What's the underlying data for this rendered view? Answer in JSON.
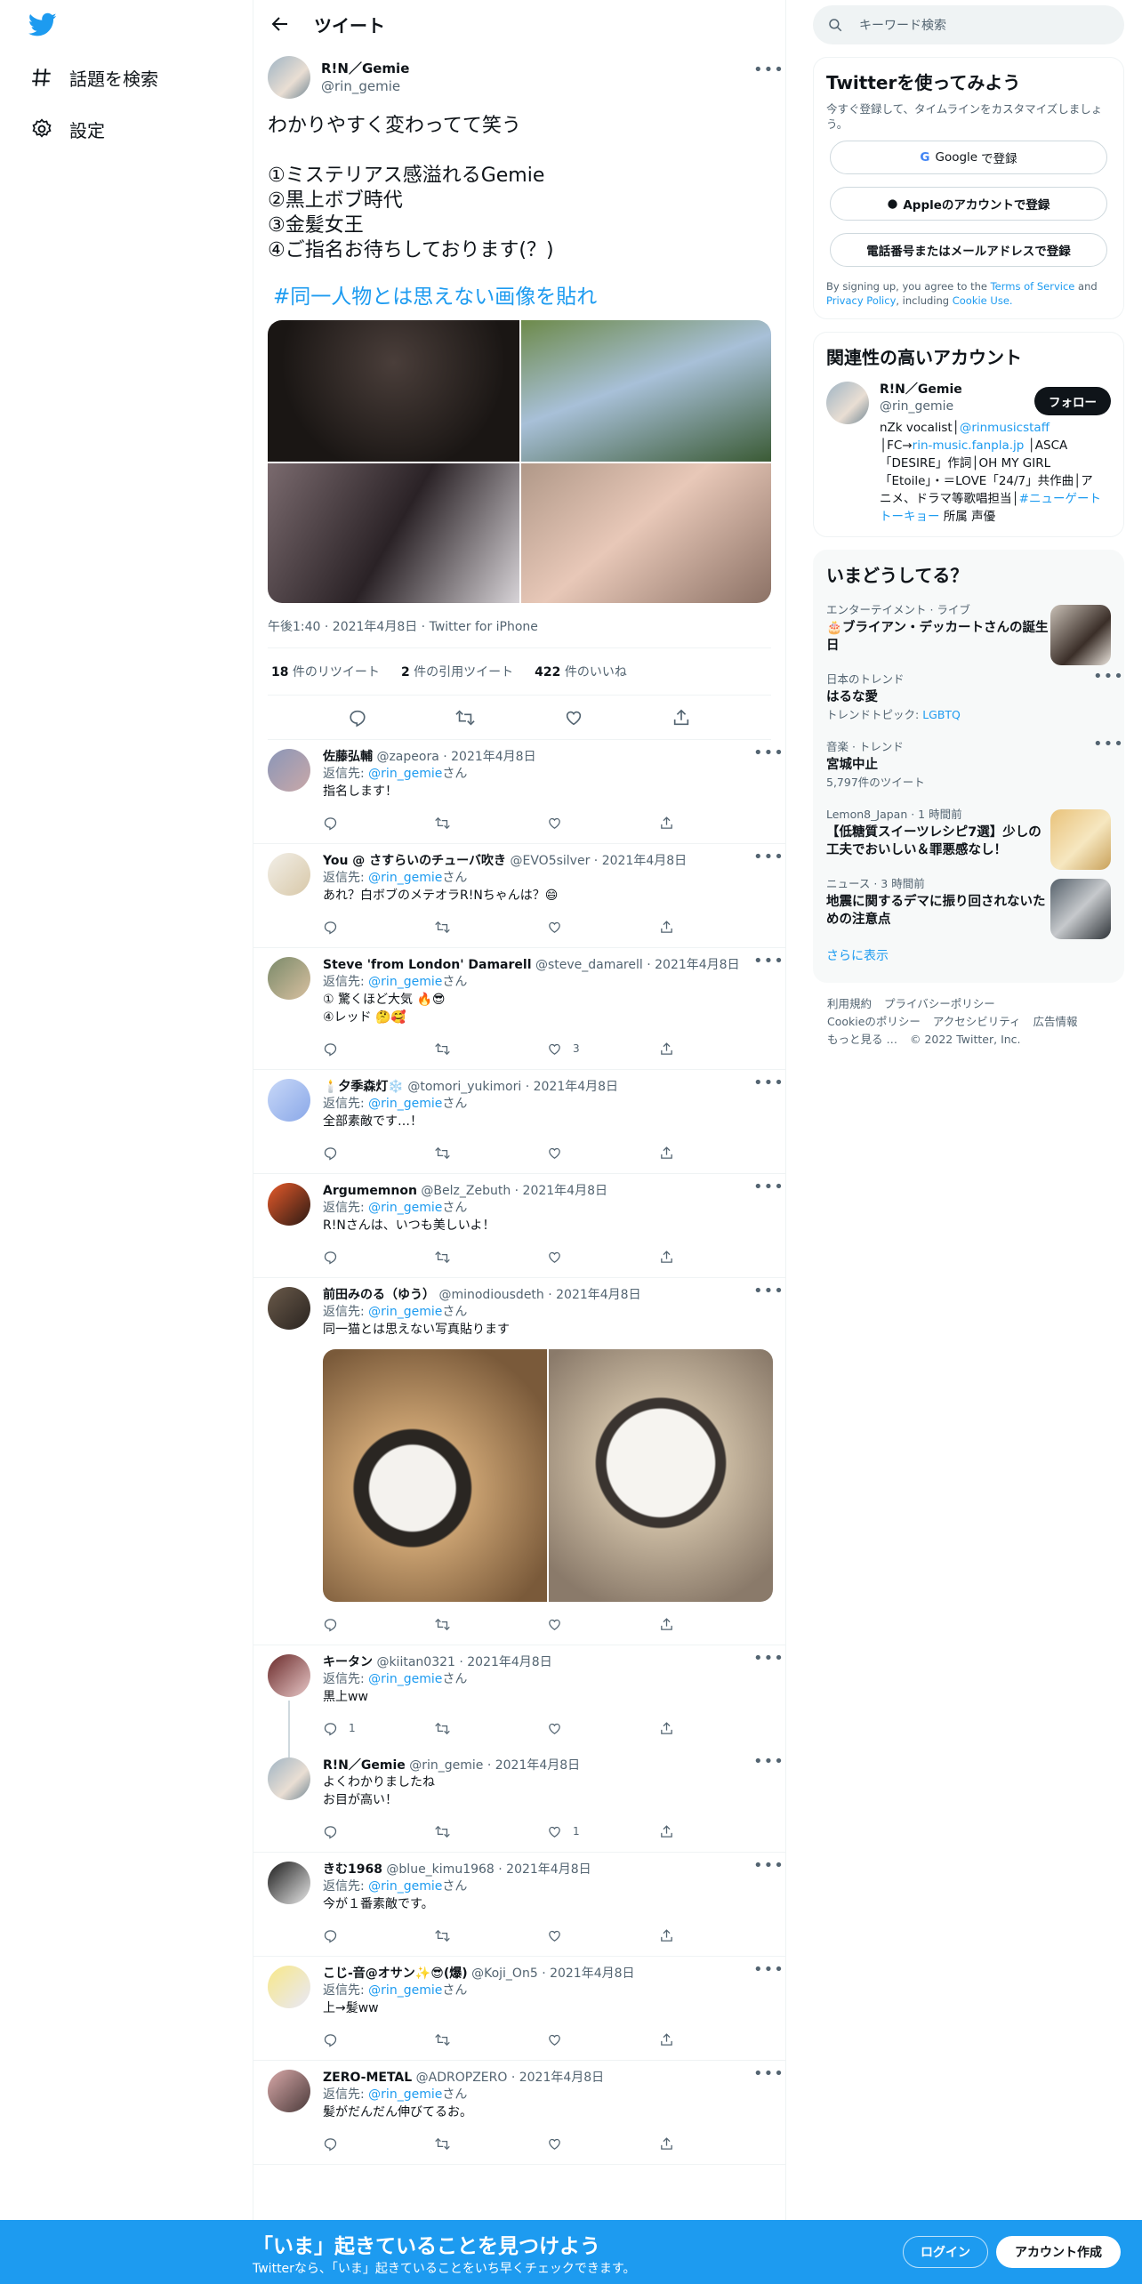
{
  "nav": {
    "explore_label": "話題を検索",
    "settings_label": "設定"
  },
  "header": {
    "title": "ツイート"
  },
  "main_tweet": {
    "name": "R!N／Gemie",
    "handle": "@rin_gemie",
    "text": "わかりやすく変わってて笑う\n\n①ミステリアス感溢れるGemie\n②黒上ボブ時代\n③金髪女王\n④ご指名お待ちしております(？)",
    "hashtag": "#同一人物とは思えない画像を貼れ",
    "meta": "午後1:40 · 2021年4月8日 · Twitter for iPhone",
    "retweets_count": "18",
    "retweets_label": " 件のリツイート",
    "quotes_count": "2",
    "quotes_label": " 件の引用ツイート",
    "likes_count": "422",
    "likes_label": " 件のいいね"
  },
  "reply_to_label": "返信先: ",
  "reply_to_suffix": "さん",
  "replies": [
    {
      "name": "佐藤弘輔",
      "handle": "@zapeora",
      "date": "· 2021年4月8日",
      "reply_to": "@rin_gemie",
      "text": "指名します！",
      "replies": "",
      "likes": ""
    },
    {
      "name": "You @ さすらいのチューバ吹き",
      "handle": "@EVO5silver",
      "date": "· 2021年4月8日",
      "reply_to": "@rin_gemie",
      "text": "あれ？白ボブのメテオラR!Nちゃんは？😄",
      "replies": "",
      "likes": ""
    },
    {
      "name": "Steve 'from London' Damarell",
      "handle": "@steve_damarell",
      "date": "· 2021年4月8日",
      "reply_to": "@rin_gemie",
      "text": "① 驚くほど大気 🔥😎\n④レッド 🤔🥰",
      "replies": "",
      "likes": "3"
    },
    {
      "name": "🕯️夕季森灯❄️",
      "handle": "@tomori_yukimori",
      "date": "· 2021年4月8日",
      "reply_to": "@rin_gemie",
      "text": "全部素敵です…！",
      "replies": "",
      "likes": ""
    },
    {
      "name": "Argumemnon",
      "handle": "@Belz_Zebuth",
      "date": "· 2021年4月8日",
      "reply_to": "@rin_gemie",
      "text": "R!Nさんは、いつも美しいよ！",
      "replies": "",
      "likes": ""
    },
    {
      "name": "前田みのる（ゆう）",
      "handle": "@minodiousdeth",
      "date": "· 2021年4月8日",
      "reply_to": "@rin_gemie",
      "text": "同一猫とは思えない写真貼ります",
      "replies": "",
      "likes": ""
    },
    {
      "name": "キータン",
      "handle": "@kiitan0321",
      "date": "· 2021年4月8日",
      "reply_to": "@rin_gemie",
      "text": "黒上ww",
      "replies": "1",
      "likes": ""
    },
    {
      "name": "R!N／Gemie",
      "handle": "@rin_gemie",
      "date": "· 2021年4月8日",
      "reply_to": "",
      "text": "よくわかりましたね\nお目が高い！",
      "replies": "",
      "likes": "1"
    },
    {
      "name": "きむ1968",
      "handle": "@blue_kimu1968",
      "date": "· 2021年4月8日",
      "reply_to": "@rin_gemie",
      "text": "今が１番素敵です。",
      "replies": "",
      "likes": ""
    },
    {
      "name": "こじ-音@オサン✨😎(爆)",
      "handle": "@Koji_On5",
      "date": "· 2021年4月8日",
      "reply_to": "@rin_gemie",
      "text": "上→髪ww",
      "replies": "",
      "likes": ""
    },
    {
      "name": "ZERO-METAL",
      "handle": "@ADROPZERO",
      "date": "· 2021年4月8日",
      "reply_to": "@rin_gemie",
      "text": "髪がだんだん伸びてるお。",
      "replies": "",
      "likes": ""
    }
  ],
  "search": {
    "placeholder": "キーワード検索"
  },
  "signup": {
    "title": "Twitterを使ってみよう",
    "subtitle": "今すぐ登録して、タイムラインをカスタマイズしましょう。",
    "google_label": "Google",
    "google_suffix": "で登録",
    "apple_label": "Appleのアカウントで登録",
    "phone_label": "電話番号またはメールアドレスで登録",
    "legal_prefix": "By signing up, you agree to the ",
    "terms": "Terms of Service",
    "and": " and ",
    "privacy": "Privacy Policy",
    "including": ", including ",
    "cookie": "Cookie Use."
  },
  "related": {
    "title": "関連性の高いアカウント",
    "name": "R!N／Gemie",
    "handle": "@rin_gemie",
    "follow_label": "フォロー",
    "bio_1": "nZk vocalist│",
    "bio_link_1": "@rinmusicstaff",
    "bio_2": " │FC→",
    "bio_link_2": "rin-music.fanpla.jp",
    "bio_3": " │ASCA「DESIRE」作詞│OH MY GIRL「Etoile」・＝LOVE「24/7」共作曲│アニメ、ドラマ等歌唱担当│",
    "bio_link_3": "#ニューゲートトーキョー",
    "bio_4": " 所属 声優"
  },
  "trends": {
    "title": "いまどうしてる？",
    "items": [
      {
        "context": "エンターテイメント · ライブ",
        "title": "🎂ブライアン・デッカートさんの誕生日",
        "sub": ""
      },
      {
        "context": "日本のトレンド",
        "title": "はるな愛",
        "sub_prefix": "トレンドトピック: ",
        "sub_link": "LGBTQ"
      },
      {
        "context": "音楽 · トレンド",
        "title": "宮城中止",
        "sub": "5,797件のツイート"
      },
      {
        "context": "Lemon8_Japan · 1 時間前",
        "title": "【低糖質スイーツレシピ7選】少しの工夫でおいしい＆罪悪感なし！",
        "sub": ""
      },
      {
        "context": "ニュース · 3 時間前",
        "title": "地震に関するデマに振り回されないための注意点",
        "sub": ""
      }
    ],
    "show_more": "さらに表示"
  },
  "footer": {
    "links": [
      "利用規約",
      "プライバシーポリシー",
      "Cookieのポリシー",
      "アクセシビリティ",
      "広告情報",
      "もっと見る …",
      "© 2022 Twitter, Inc."
    ]
  },
  "bottom_bar": {
    "title": "「いま」起きていることを見つけよう",
    "subtitle": "Twitterなら、「いま」起きていることをいち早くチェックできます。",
    "login_label": "ログイン",
    "signup_label": "アカウント作成"
  },
  "colors": {
    "accent": "#1d9bf0",
    "text": "#0f1419",
    "secondary": "#536471",
    "border": "#eff3f4"
  }
}
